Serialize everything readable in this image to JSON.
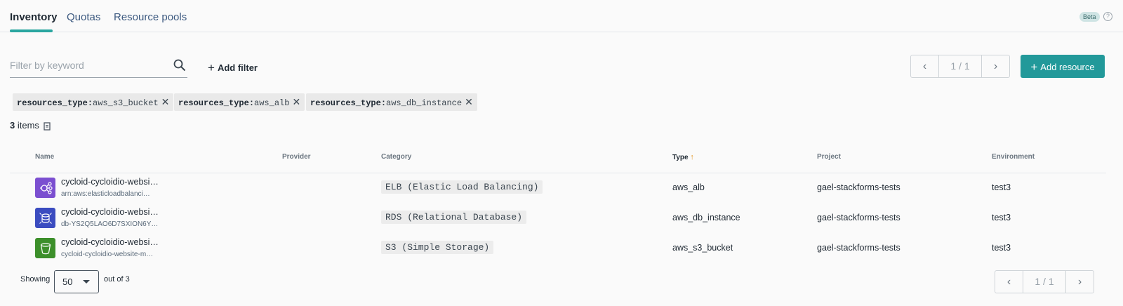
{
  "tabs": [
    {
      "label": "Inventory",
      "active": true
    },
    {
      "label": "Quotas",
      "active": false
    },
    {
      "label": "Resource pools",
      "active": false
    }
  ],
  "beta_badge": "Beta",
  "help_icon": "help-circle-icon",
  "filter": {
    "placeholder": "Filter by keyword",
    "value": "",
    "search_icon": "search-icon"
  },
  "add_filter_label": "Add filter",
  "pagination_top": {
    "page": "1 / 1"
  },
  "add_resource_label": "Add resource",
  "chips": [
    {
      "key": "resources_type:",
      "value": "aws_s3_bucket"
    },
    {
      "key": "resources_type:",
      "value": "aws_alb"
    },
    {
      "key": "resources_type:",
      "value": "aws_db_instance"
    }
  ],
  "items_count": "3",
  "items_label": "items",
  "columns": {
    "name": "Name",
    "provider": "Provider",
    "category": "Category",
    "type": "Type",
    "project": "Project",
    "environment": "Environment"
  },
  "sort": {
    "column": "Type",
    "direction": "ascending",
    "icon": "arrow-up-icon"
  },
  "rows": [
    {
      "name": "cycloid-cycloidio-websi…",
      "sub": "arn:aws:elasticloadbalanci…",
      "category": "ELB (Elastic Load Balancing)",
      "type": "aws_alb",
      "project": "gael-stackforms-tests",
      "environment": "test3",
      "icon": "load-balancer-icon",
      "icon_color": "#7b4fd0"
    },
    {
      "name": "cycloid-cycloidio-websi…",
      "sub": "db-YS2Q5LAO6D7SXION6Y…",
      "category": "RDS (Relational Database)",
      "type": "aws_db_instance",
      "project": "gael-stackforms-tests",
      "environment": "test3",
      "icon": "database-icon",
      "icon_color": "#3b4cc0"
    },
    {
      "name": "cycloid-cycloidio-websi…",
      "sub": "cycloid-cycloidio-website-m…",
      "category": "S3 (Simple Storage)",
      "type": "aws_s3_bucket",
      "project": "gael-stackforms-tests",
      "environment": "test3",
      "icon": "bucket-icon",
      "icon_color": "#3c8f2a"
    }
  ],
  "footer": {
    "showing_label": "Showing",
    "per_page": "50",
    "out_of": "out of 3",
    "page": "1 / 1"
  },
  "colors": {
    "accent": "#22999a",
    "sort_arrow": "#e39a2a"
  }
}
